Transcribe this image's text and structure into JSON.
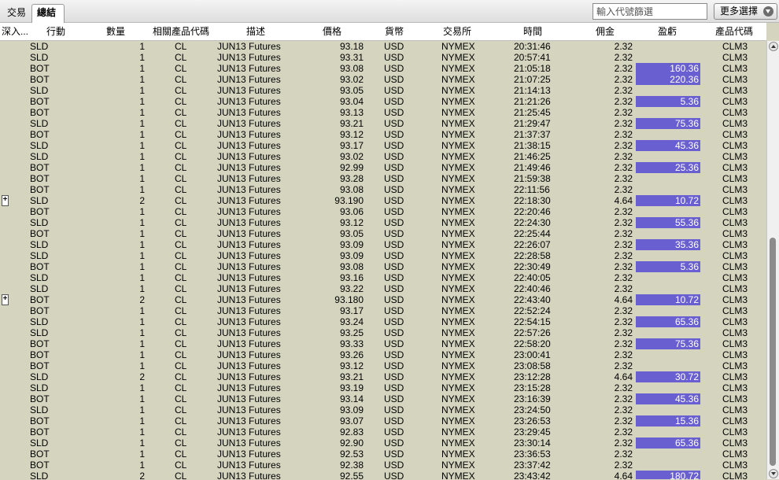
{
  "tabs": [
    {
      "label": "交易",
      "active": false
    },
    {
      "label": "總結",
      "active": true
    }
  ],
  "filter": {
    "placeholder": "輸入代號篩選"
  },
  "more_button": {
    "label": "更多選擇"
  },
  "columns": {
    "drill": "深入...",
    "action": "行動",
    "quantity": "數量",
    "symbol": "相關產品代碼",
    "description": "描述",
    "price": "價格",
    "currency": "貨幣",
    "exchange": "交易所",
    "time": "時間",
    "commission": "佣金",
    "pnl": "盈虧",
    "code": "產品代碼"
  },
  "colors": {
    "pnl_highlight": "#6a5fd0",
    "grid_background": "#d4d4bf"
  },
  "rows": [
    {
      "action": "SLD",
      "qty": "1",
      "price": "93.18",
      "time": "20:31:46",
      "comm": "2.32",
      "pnl": ""
    },
    {
      "action": "SLD",
      "qty": "1",
      "price": "93.31",
      "time": "20:57:41",
      "comm": "2.32",
      "pnl": ""
    },
    {
      "action": "BOT",
      "qty": "1",
      "price": "93.08",
      "time": "21:05:18",
      "comm": "2.32",
      "pnl": "160.36"
    },
    {
      "action": "BOT",
      "qty": "1",
      "price": "93.02",
      "time": "21:07:25",
      "comm": "2.32",
      "pnl": "220.36"
    },
    {
      "action": "SLD",
      "qty": "1",
      "price": "93.05",
      "time": "21:14:13",
      "comm": "2.32",
      "pnl": ""
    },
    {
      "action": "BOT",
      "qty": "1",
      "price": "93.04",
      "time": "21:21:26",
      "comm": "2.32",
      "pnl": "5.36"
    },
    {
      "action": "BOT",
      "qty": "1",
      "price": "93.13",
      "time": "21:25:45",
      "comm": "2.32",
      "pnl": ""
    },
    {
      "action": "SLD",
      "qty": "1",
      "price": "93.21",
      "time": "21:29:47",
      "comm": "2.32",
      "pnl": "75.36"
    },
    {
      "action": "BOT",
      "qty": "1",
      "price": "93.12",
      "time": "21:37:37",
      "comm": "2.32",
      "pnl": ""
    },
    {
      "action": "SLD",
      "qty": "1",
      "price": "93.17",
      "time": "21:38:15",
      "comm": "2.32",
      "pnl": "45.36"
    },
    {
      "action": "SLD",
      "qty": "1",
      "price": "93.02",
      "time": "21:46:25",
      "comm": "2.32",
      "pnl": ""
    },
    {
      "action": "BOT",
      "qty": "1",
      "price": "92.99",
      "time": "21:49:46",
      "comm": "2.32",
      "pnl": "25.36"
    },
    {
      "action": "BOT",
      "qty": "1",
      "price": "93.28",
      "time": "21:59:38",
      "comm": "2.32",
      "pnl": ""
    },
    {
      "action": "BOT",
      "qty": "1",
      "price": "93.08",
      "time": "22:11:56",
      "comm": "2.32",
      "pnl": ""
    },
    {
      "action": "SLD",
      "qty": "2",
      "price": "93.190",
      "time": "22:18:30",
      "comm": "4.64",
      "pnl": "10.72",
      "expandable": true
    },
    {
      "action": "BOT",
      "qty": "1",
      "price": "93.06",
      "time": "22:20:46",
      "comm": "2.32",
      "pnl": ""
    },
    {
      "action": "SLD",
      "qty": "1",
      "price": "93.12",
      "time": "22:24:30",
      "comm": "2.32",
      "pnl": "55.36"
    },
    {
      "action": "BOT",
      "qty": "1",
      "price": "93.05",
      "time": "22:25:44",
      "comm": "2.32",
      "pnl": ""
    },
    {
      "action": "SLD",
      "qty": "1",
      "price": "93.09",
      "time": "22:26:07",
      "comm": "2.32",
      "pnl": "35.36"
    },
    {
      "action": "SLD",
      "qty": "1",
      "price": "93.09",
      "time": "22:28:58",
      "comm": "2.32",
      "pnl": ""
    },
    {
      "action": "BOT",
      "qty": "1",
      "price": "93.08",
      "time": "22:30:49",
      "comm": "2.32",
      "pnl": "5.36"
    },
    {
      "action": "SLD",
      "qty": "1",
      "price": "93.16",
      "time": "22:40:05",
      "comm": "2.32",
      "pnl": ""
    },
    {
      "action": "SLD",
      "qty": "1",
      "price": "93.22",
      "time": "22:40:46",
      "comm": "2.32",
      "pnl": ""
    },
    {
      "action": "BOT",
      "qty": "2",
      "price": "93.180",
      "time": "22:43:40",
      "comm": "4.64",
      "pnl": "10.72",
      "expandable": true
    },
    {
      "action": "BOT",
      "qty": "1",
      "price": "93.17",
      "time": "22:52:24",
      "comm": "2.32",
      "pnl": ""
    },
    {
      "action": "SLD",
      "qty": "1",
      "price": "93.24",
      "time": "22:54:15",
      "comm": "2.32",
      "pnl": "65.36"
    },
    {
      "action": "SLD",
      "qty": "1",
      "price": "93.25",
      "time": "22:57:26",
      "comm": "2.32",
      "pnl": ""
    },
    {
      "action": "BOT",
      "qty": "1",
      "price": "93.33",
      "time": "22:58:20",
      "comm": "2.32",
      "pnl": "75.36"
    },
    {
      "action": "BOT",
      "qty": "1",
      "price": "93.26",
      "time": "23:00:41",
      "comm": "2.32",
      "pnl": ""
    },
    {
      "action": "BOT",
      "qty": "1",
      "price": "93.12",
      "time": "23:08:58",
      "comm": "2.32",
      "pnl": ""
    },
    {
      "action": "SLD",
      "qty": "2",
      "price": "93.21",
      "time": "23:12:28",
      "comm": "4.64",
      "pnl": "30.72"
    },
    {
      "action": "SLD",
      "qty": "1",
      "price": "93.19",
      "time": "23:15:28",
      "comm": "2.32",
      "pnl": ""
    },
    {
      "action": "BOT",
      "qty": "1",
      "price": "93.14",
      "time": "23:16:39",
      "comm": "2.32",
      "pnl": "45.36"
    },
    {
      "action": "SLD",
      "qty": "1",
      "price": "93.09",
      "time": "23:24:50",
      "comm": "2.32",
      "pnl": ""
    },
    {
      "action": "BOT",
      "qty": "1",
      "price": "93.07",
      "time": "23:26:53",
      "comm": "2.32",
      "pnl": "15.36"
    },
    {
      "action": "BOT",
      "qty": "1",
      "price": "92.83",
      "time": "23:29:45",
      "comm": "2.32",
      "pnl": ""
    },
    {
      "action": "SLD",
      "qty": "1",
      "price": "92.90",
      "time": "23:30:14",
      "comm": "2.32",
      "pnl": "65.36"
    },
    {
      "action": "BOT",
      "qty": "1",
      "price": "92.53",
      "time": "23:36:53",
      "comm": "2.32",
      "pnl": ""
    },
    {
      "action": "BOT",
      "qty": "1",
      "price": "92.38",
      "time": "23:37:42",
      "comm": "2.32",
      "pnl": ""
    },
    {
      "action": "SLD",
      "qty": "2",
      "price": "92.55",
      "time": "23:43:42",
      "comm": "4.64",
      "pnl": "180.72"
    }
  ],
  "row_defaults": {
    "symbol": "CL",
    "description": "JUN13 Futures",
    "currency": "USD",
    "exchange": "NYMEX",
    "code": "CLM3"
  }
}
